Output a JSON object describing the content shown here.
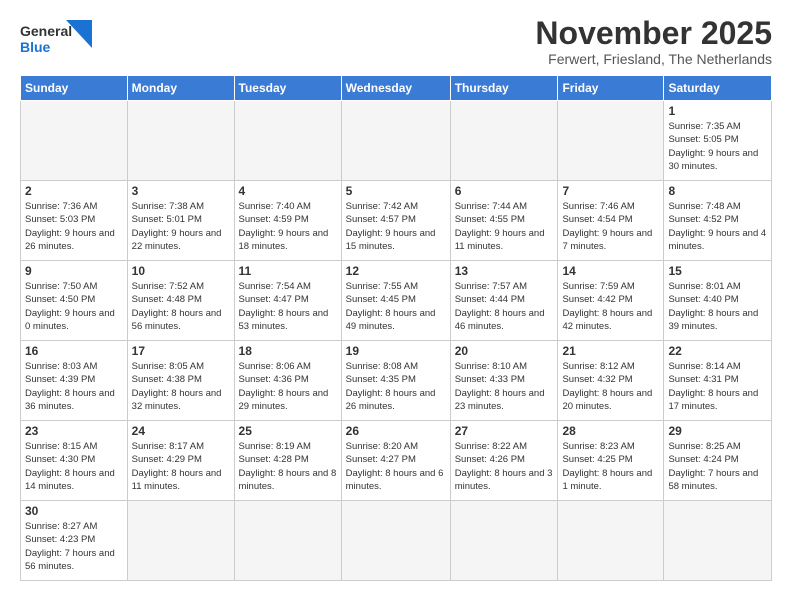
{
  "header": {
    "logo_general": "General",
    "logo_blue": "Blue",
    "month_title": "November 2025",
    "location": "Ferwert, Friesland, The Netherlands"
  },
  "weekdays": [
    "Sunday",
    "Monday",
    "Tuesday",
    "Wednesday",
    "Thursday",
    "Friday",
    "Saturday"
  ],
  "days": {
    "d1": {
      "n": "1",
      "sr": "7:35 AM",
      "ss": "5:05 PM",
      "dl": "9 hours and 30 minutes."
    },
    "d2": {
      "n": "2",
      "sr": "7:36 AM",
      "ss": "5:03 PM",
      "dl": "9 hours and 26 minutes."
    },
    "d3": {
      "n": "3",
      "sr": "7:38 AM",
      "ss": "5:01 PM",
      "dl": "9 hours and 22 minutes."
    },
    "d4": {
      "n": "4",
      "sr": "7:40 AM",
      "ss": "4:59 PM",
      "dl": "9 hours and 18 minutes."
    },
    "d5": {
      "n": "5",
      "sr": "7:42 AM",
      "ss": "4:57 PM",
      "dl": "9 hours and 15 minutes."
    },
    "d6": {
      "n": "6",
      "sr": "7:44 AM",
      "ss": "4:55 PM",
      "dl": "9 hours and 11 minutes."
    },
    "d7": {
      "n": "7",
      "sr": "7:46 AM",
      "ss": "4:54 PM",
      "dl": "9 hours and 7 minutes."
    },
    "d8": {
      "n": "8",
      "sr": "7:48 AM",
      "ss": "4:52 PM",
      "dl": "9 hours and 4 minutes."
    },
    "d9": {
      "n": "9",
      "sr": "7:50 AM",
      "ss": "4:50 PM",
      "dl": "9 hours and 0 minutes."
    },
    "d10": {
      "n": "10",
      "sr": "7:52 AM",
      "ss": "4:48 PM",
      "dl": "8 hours and 56 minutes."
    },
    "d11": {
      "n": "11",
      "sr": "7:54 AM",
      "ss": "4:47 PM",
      "dl": "8 hours and 53 minutes."
    },
    "d12": {
      "n": "12",
      "sr": "7:55 AM",
      "ss": "4:45 PM",
      "dl": "8 hours and 49 minutes."
    },
    "d13": {
      "n": "13",
      "sr": "7:57 AM",
      "ss": "4:44 PM",
      "dl": "8 hours and 46 minutes."
    },
    "d14": {
      "n": "14",
      "sr": "7:59 AM",
      "ss": "4:42 PM",
      "dl": "8 hours and 42 minutes."
    },
    "d15": {
      "n": "15",
      "sr": "8:01 AM",
      "ss": "4:40 PM",
      "dl": "8 hours and 39 minutes."
    },
    "d16": {
      "n": "16",
      "sr": "8:03 AM",
      "ss": "4:39 PM",
      "dl": "8 hours and 36 minutes."
    },
    "d17": {
      "n": "17",
      "sr": "8:05 AM",
      "ss": "4:38 PM",
      "dl": "8 hours and 32 minutes."
    },
    "d18": {
      "n": "18",
      "sr": "8:06 AM",
      "ss": "4:36 PM",
      "dl": "8 hours and 29 minutes."
    },
    "d19": {
      "n": "19",
      "sr": "8:08 AM",
      "ss": "4:35 PM",
      "dl": "8 hours and 26 minutes."
    },
    "d20": {
      "n": "20",
      "sr": "8:10 AM",
      "ss": "4:33 PM",
      "dl": "8 hours and 23 minutes."
    },
    "d21": {
      "n": "21",
      "sr": "8:12 AM",
      "ss": "4:32 PM",
      "dl": "8 hours and 20 minutes."
    },
    "d22": {
      "n": "22",
      "sr": "8:14 AM",
      "ss": "4:31 PM",
      "dl": "8 hours and 17 minutes."
    },
    "d23": {
      "n": "23",
      "sr": "8:15 AM",
      "ss": "4:30 PM",
      "dl": "8 hours and 14 minutes."
    },
    "d24": {
      "n": "24",
      "sr": "8:17 AM",
      "ss": "4:29 PM",
      "dl": "8 hours and 11 minutes."
    },
    "d25": {
      "n": "25",
      "sr": "8:19 AM",
      "ss": "4:28 PM",
      "dl": "8 hours and 8 minutes."
    },
    "d26": {
      "n": "26",
      "sr": "8:20 AM",
      "ss": "4:27 PM",
      "dl": "8 hours and 6 minutes."
    },
    "d27": {
      "n": "27",
      "sr": "8:22 AM",
      "ss": "4:26 PM",
      "dl": "8 hours and 3 minutes."
    },
    "d28": {
      "n": "28",
      "sr": "8:23 AM",
      "ss": "4:25 PM",
      "dl": "8 hours and 1 minute."
    },
    "d29": {
      "n": "29",
      "sr": "8:25 AM",
      "ss": "4:24 PM",
      "dl": "7 hours and 58 minutes."
    },
    "d30": {
      "n": "30",
      "sr": "8:27 AM",
      "ss": "4:23 PM",
      "dl": "7 hours and 56 minutes."
    }
  }
}
